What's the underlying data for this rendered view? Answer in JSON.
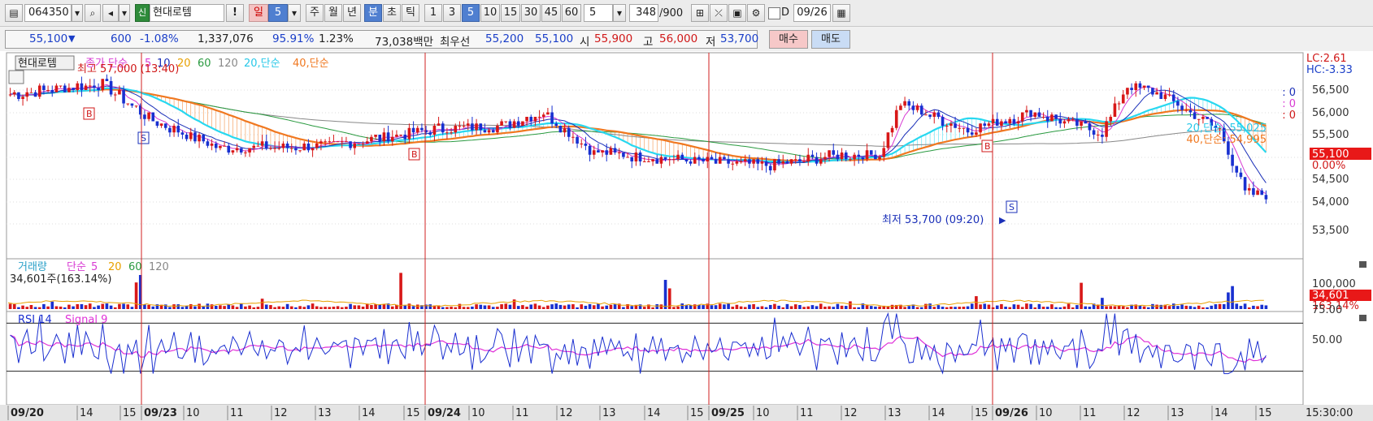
{
  "toolbar": {
    "code": "064350",
    "badge": "신",
    "stock_name": "현대로템",
    "alert": "!",
    "period_day": "일",
    "period_num": "5",
    "period_week": "주",
    "period_month": "월",
    "period_year": "년",
    "period_min": "분",
    "period_sec": "초",
    "period_tick": "틱",
    "intervals": [
      "1",
      "3",
      "5",
      "10",
      "15",
      "30",
      "45",
      "60"
    ],
    "interval_value": "5",
    "count_value": "348",
    "count_total": "/900",
    "check_label": "D",
    "date_value": "09/26"
  },
  "info": {
    "price": "55,100",
    "change": "600",
    "change_pct": "-1.08%",
    "volume": "1,337,076",
    "vol_ratio": "95.91%",
    "turnover_pct": "1.23%",
    "amount": "73,038백만",
    "best_label": "최우선",
    "ask": "55,200",
    "bid": "55,100",
    "open_label": "시",
    "open": "55,900",
    "high_label": "고",
    "high": "56,000",
    "low_label": "저",
    "low": "53,700",
    "buy": "매수",
    "sell": "매도"
  },
  "price_panel": {
    "name": "현대로템",
    "legend_prefix": "종가 단순",
    "ma": [
      "5",
      "10",
      "20",
      "60",
      "120"
    ],
    "ma_extra": [
      "20,단순",
      "40,단순"
    ],
    "high_note": "최고 57,000 (13:40)",
    "low_note": "최저 53,700 (09:20)",
    "lc": "LC:2.61",
    "hc": "HC:-3.33",
    "zeros": [
      ": 0",
      ": 0",
      ": 0"
    ],
    "ma20_label": "20,단순: 55,025",
    "ma40_label": "40,단순: 54,995",
    "current": "55,100",
    "current_pct": "0.00%",
    "yticks": [
      "56,500",
      "56,000",
      "55,500",
      "55,000",
      "54,500",
      "54,000",
      "53,500"
    ],
    "marks": [
      "B",
      "S",
      "B",
      "B",
      "S"
    ]
  },
  "volume_panel": {
    "title": "거래량",
    "legend_prefix": "단순",
    "ma": [
      "5",
      "20",
      "60",
      "120"
    ],
    "current_note": "34,601주(163.14%)",
    "ytick": "100,000",
    "current": "34,601",
    "current_pct": "163.14%"
  },
  "rsi_panel": {
    "title": "RSI 14",
    "signal": "Signal 9",
    "yticks": [
      "75.00",
      "50.00"
    ]
  },
  "xaxis": {
    "labels": [
      "09/20",
      "14",
      "15",
      "09/23",
      "10",
      "11",
      "12",
      "13",
      "14",
      "15",
      "09/24",
      "10",
      "11",
      "12",
      "13",
      "14",
      "15",
      "09/25",
      "10",
      "11",
      "12",
      "13",
      "14",
      "15",
      "09/26",
      "10",
      "11",
      "12",
      "13",
      "14",
      "15"
    ],
    "time": "15:30:00"
  },
  "colors": {
    "up": "#d81818",
    "down": "#1830d0",
    "ma5": "#d83bd3",
    "ma10": "#1a2fb8",
    "ma20": "#e8a000",
    "ma60": "#2a9a40",
    "ma120": "#888888",
    "ma20s": "#28d8f0",
    "ma40s": "#f07820",
    "rsi": "#1a2fd0",
    "signal": "#e030d8",
    "current_bg": "#e81818"
  }
}
